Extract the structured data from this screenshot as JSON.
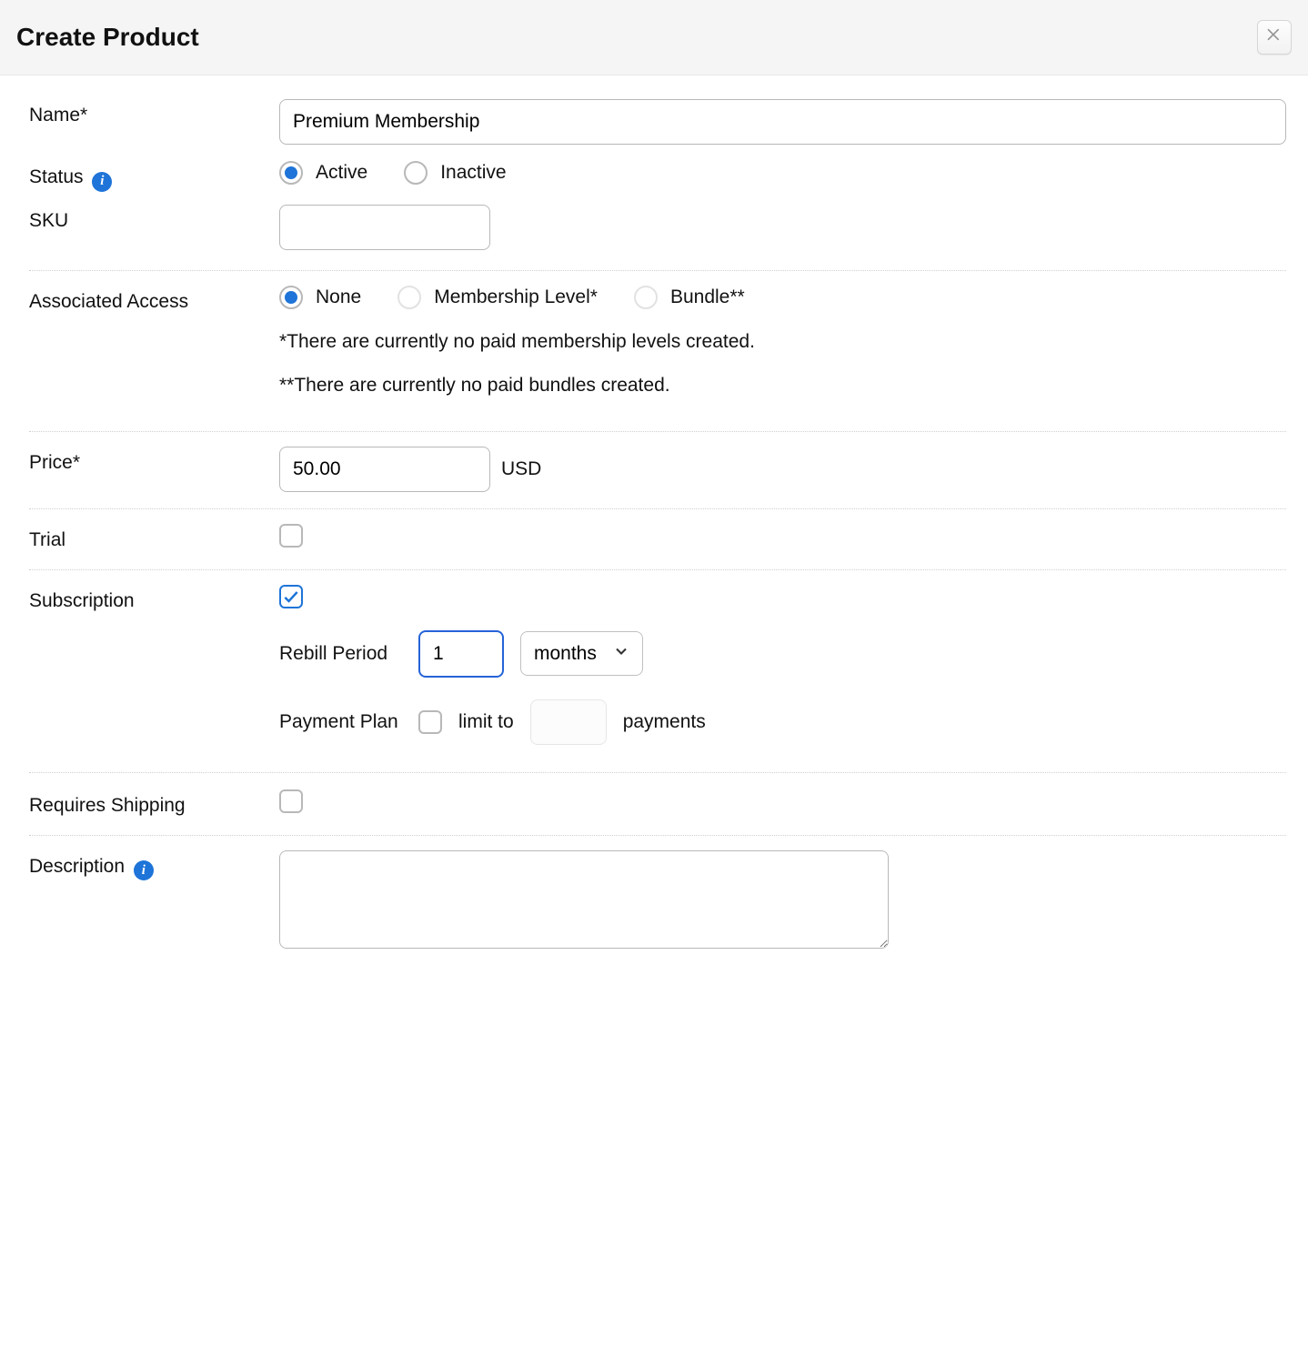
{
  "header": {
    "title": "Create Product"
  },
  "labels": {
    "name": "Name*",
    "status": "Status",
    "sku": "SKU",
    "associated_access": "Associated Access",
    "price": "Price*",
    "trial": "Trial",
    "subscription": "Subscription",
    "rebill_period": "Rebill Period",
    "payment_plan": "Payment Plan",
    "limit_to": "limit to",
    "payments": "payments",
    "requires_shipping": "Requires Shipping",
    "description": "Description"
  },
  "status_options": {
    "active": "Active",
    "inactive": "Inactive"
  },
  "access_options": {
    "none": "None",
    "membership": "Membership Level*",
    "bundle": "Bundle**"
  },
  "access_notes": {
    "membership": "*There are currently no paid membership levels created.",
    "bundle": "**There are currently no paid bundles created."
  },
  "values": {
    "name": "Premium Membership",
    "sku": "",
    "status": "active",
    "access": "none",
    "price": "50.00",
    "currency": "USD",
    "trial": false,
    "subscription": true,
    "rebill_qty": "1",
    "rebill_unit": "months",
    "payment_plan_enabled": false,
    "payment_plan_count": "",
    "requires_shipping": false,
    "description": ""
  }
}
